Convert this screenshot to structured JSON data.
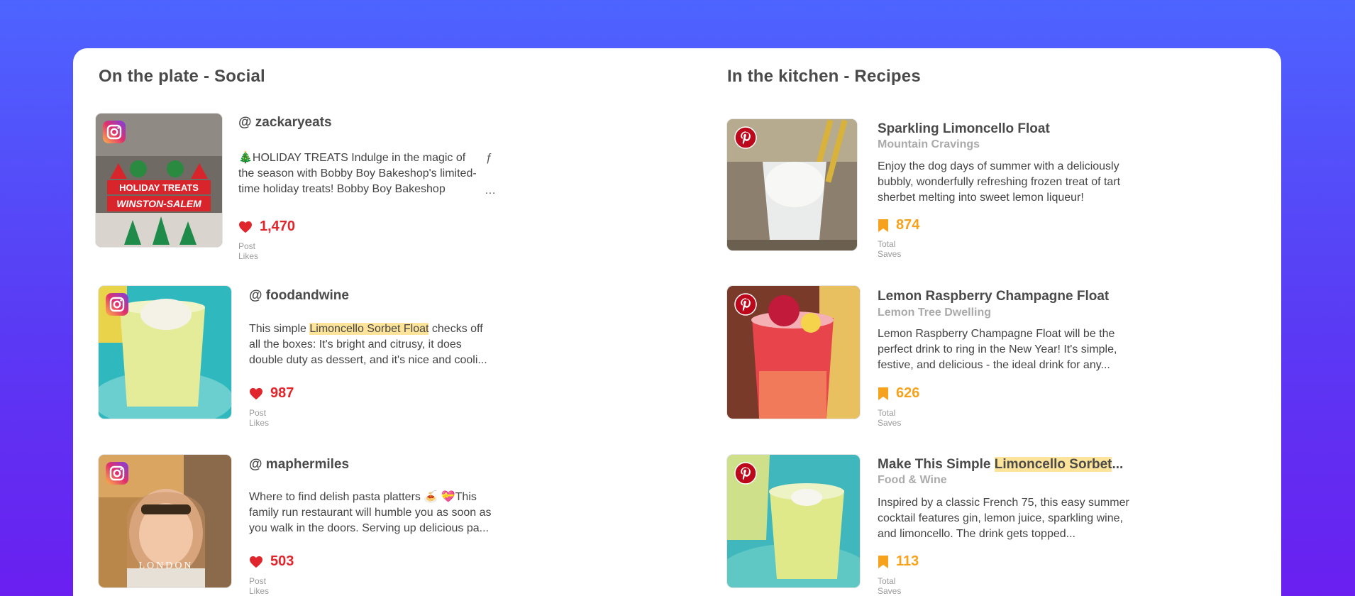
{
  "social": {
    "title": "On the plate - Social",
    "metric_label": "Post Likes",
    "posts": [
      {
        "handle": "@ zackaryeats",
        "text": "🎄HOLIDAY TREATS Indulge in the magic of the season with Bobby Boy Bakeshop's limited-time holiday treats! Bobby Boy Bakeshop presents ...",
        "likes": "1,470",
        "image_caption_1": "HOLIDAY TREATS",
        "image_caption_2": "WINSTON-SALEM",
        "platform": "instagram-icon"
      },
      {
        "handle": "@ foodandwine",
        "text_before": "This simple ",
        "text_highlight": "Limoncello Sorbet Float",
        "text_after": " checks off all the boxes: It's bright and citrusy, it does double duty as dessert, and it's nice and cooli...",
        "likes": "987",
        "platform": "instagram-icon"
      },
      {
        "handle": "@ maphermiles",
        "text": "Where to find delish pasta platters 🍝 💝This family run restaurant will humble you as soon as you walk in the doors. Serving up delicious pa...",
        "likes": "503",
        "image_caption": "LONDON",
        "platform": "instagram-icon"
      }
    ]
  },
  "recipes": {
    "title": "In the kitchen - Recipes",
    "metric_label": "Total Saves",
    "items": [
      {
        "title": "Sparkling Limoncello Float",
        "source": "Mountain Cravings",
        "text": "Enjoy the dog days of summer with a deliciously bubbly, wonderfully refreshing frozen treat of tart sherbet melting into sweet lemon liqueur!",
        "saves": "874",
        "platform": "pinterest-icon"
      },
      {
        "title": "Lemon Raspberry Champagne Float",
        "source": "Lemon Tree Dwelling",
        "text": "Lemon Raspberry Champagne Float will be the perfect drink to ring in the New Year! It's simple, festive, and delicious - the ideal drink for any...",
        "saves": "626",
        "platform": "pinterest-icon"
      },
      {
        "title_before": "Make This Simple ",
        "title_highlight": "Limoncello Sorbet",
        "title_after": "...",
        "source": "Food & Wine",
        "text": "Inspired by a classic French 75, this easy summer cocktail features gin, lemon juice, sparkling wine, and limoncello. The drink gets topped...",
        "saves": "113",
        "platform": "pinterest-icon"
      }
    ]
  },
  "colors": {
    "likes": "#e0262c",
    "saves": "#f6a21c",
    "highlight": "#fde49a",
    "pinterest": "#bd081c"
  }
}
